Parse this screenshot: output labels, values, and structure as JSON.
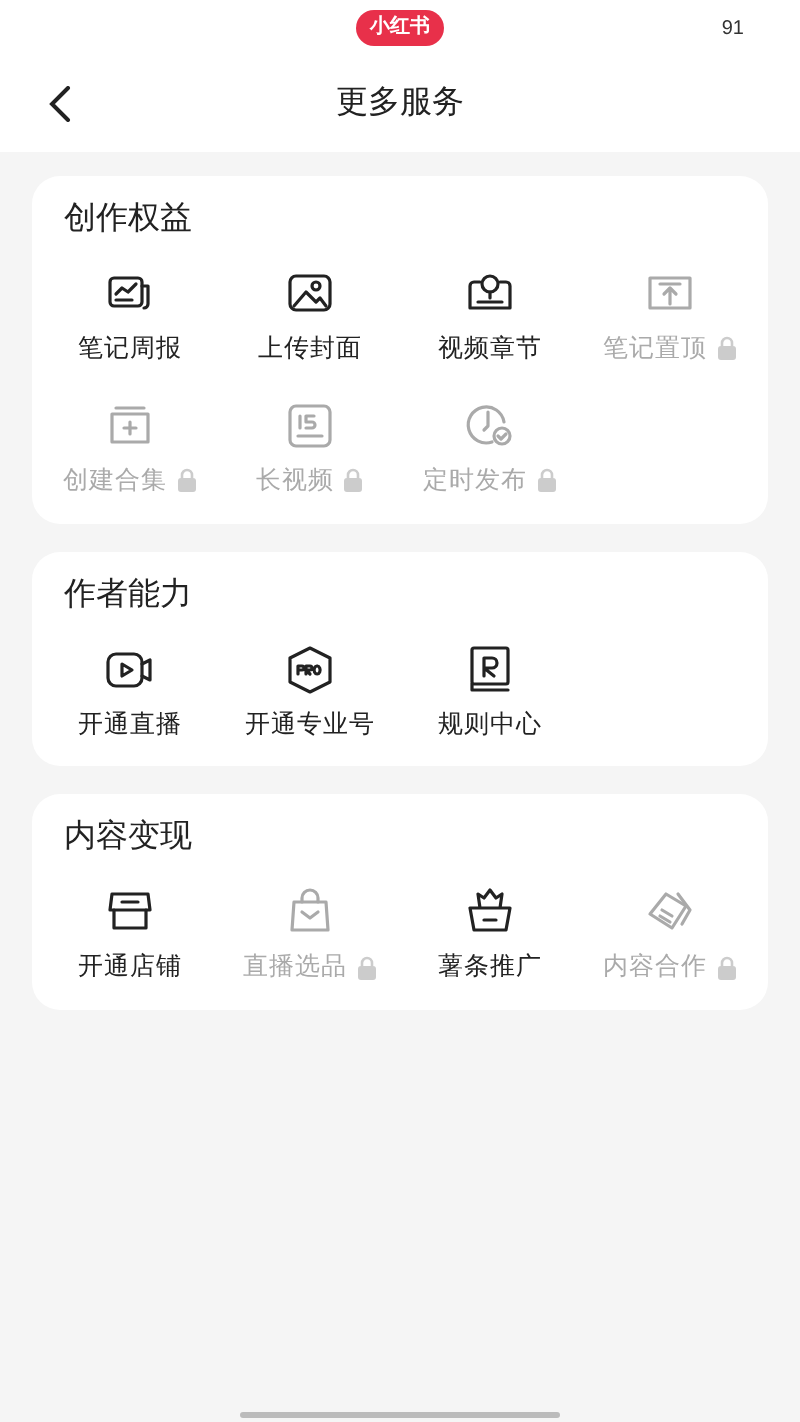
{
  "status_bar": {
    "app_badge": "小红书",
    "battery": "91"
  },
  "header": {
    "title": "更多服务"
  },
  "sections": [
    {
      "title": "创作权益",
      "items": [
        {
          "label": "笔记周报",
          "locked": false
        },
        {
          "label": "上传封面",
          "locked": false
        },
        {
          "label": "视频章节",
          "locked": false
        },
        {
          "label": "笔记置顶",
          "locked": true
        },
        {
          "label": "创建合集",
          "locked": true
        },
        {
          "label": "长视频",
          "locked": true
        },
        {
          "label": "定时发布",
          "locked": true
        }
      ]
    },
    {
      "title": "作者能力",
      "items": [
        {
          "label": "开通直播",
          "locked": false
        },
        {
          "label": "开通专业号",
          "locked": false
        },
        {
          "label": "规则中心",
          "locked": false
        }
      ]
    },
    {
      "title": "内容变现",
      "items": [
        {
          "label": "开通店铺",
          "locked": false
        },
        {
          "label": "直播选品",
          "locked": true
        },
        {
          "label": "薯条推广",
          "locked": false
        },
        {
          "label": "内容合作",
          "locked": true
        }
      ]
    }
  ]
}
